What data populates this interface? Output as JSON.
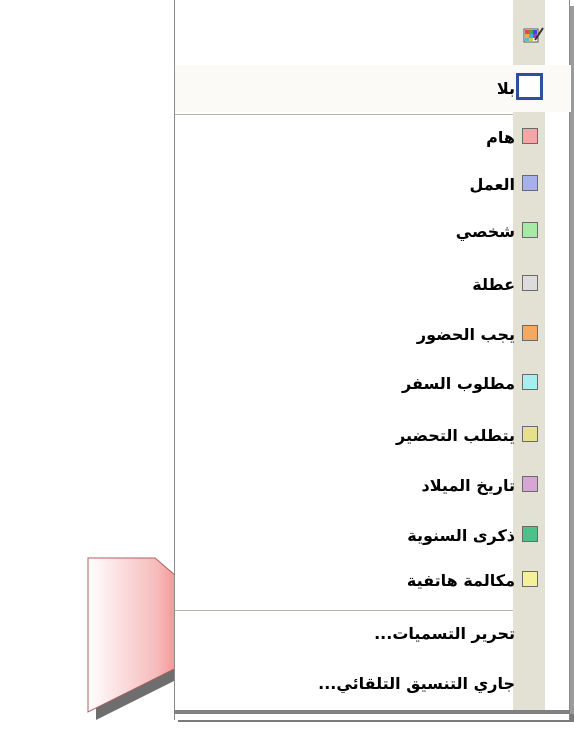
{
  "menu": {
    "none_label": "بلا",
    "items": [
      {
        "label": "هام",
        "color": "#f4a6a6"
      },
      {
        "label": "العمل",
        "color": "#a6b0ea"
      },
      {
        "label": "شخصي",
        "color": "#a6eaa6"
      },
      {
        "label": "عطلة",
        "color": "#dcdcdc"
      },
      {
        "label": "يجب الحضور",
        "color": "#f5a860"
      },
      {
        "label": "مطلوب السفر",
        "color": "#a6eef0"
      },
      {
        "label": "يتطلب التحضير",
        "color": "#e6e08c"
      },
      {
        "label": "تاريخ الميلاد",
        "color": "#d6a6d6"
      },
      {
        "label": "ذكرى السنوية",
        "color": "#4fc08a"
      },
      {
        "label": "مكالمة هاتفية",
        "color": "#f5f09a"
      }
    ],
    "edit_labels": "تحرير التسميات...",
    "auto_format": "جاري التنسيق التلقائي..."
  },
  "icons": {
    "top": "label-palette-icon",
    "arrow": "red-pointer-arrow"
  }
}
